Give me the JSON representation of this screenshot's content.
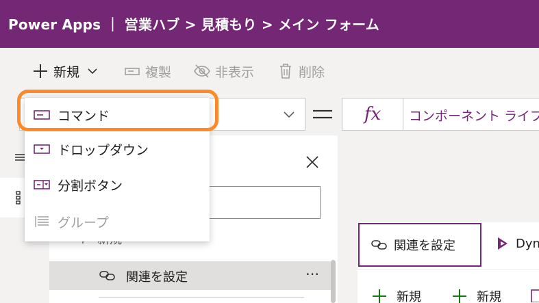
{
  "app": {
    "title": "Power Apps ｜ 営業ハブ > 見積もり > メイン フォーム"
  },
  "toolbar": {
    "new_label": "新規",
    "duplicate_label": "複製",
    "hide_label": "非表示",
    "delete_label": "削除"
  },
  "formula_bar": {
    "fx_label": "fx",
    "value": "コンポーネント ライブラリ"
  },
  "dropdown_menu": {
    "items": [
      {
        "label": "コマンド",
        "icon": "command-icon",
        "disabled": false
      },
      {
        "label": "ドロップダウン",
        "icon": "dropdown-icon",
        "disabled": false
      },
      {
        "label": "分割ボタン",
        "icon": "split-button-icon",
        "disabled": false
      },
      {
        "label": "グループ",
        "icon": "group-icon",
        "disabled": true
      }
    ]
  },
  "tree": {
    "new_label": "新規",
    "selected_item_label": "関連を設定",
    "more_label": "⋯"
  },
  "canvas": {
    "related_button_label": "関連を設定",
    "dynamics_label": "Dyn",
    "new_label_1": "新規",
    "new_label_2": "新規"
  },
  "colors": {
    "accent": "#742774",
    "highlight": "#fd8a2a",
    "new_plus": "#107c10"
  }
}
